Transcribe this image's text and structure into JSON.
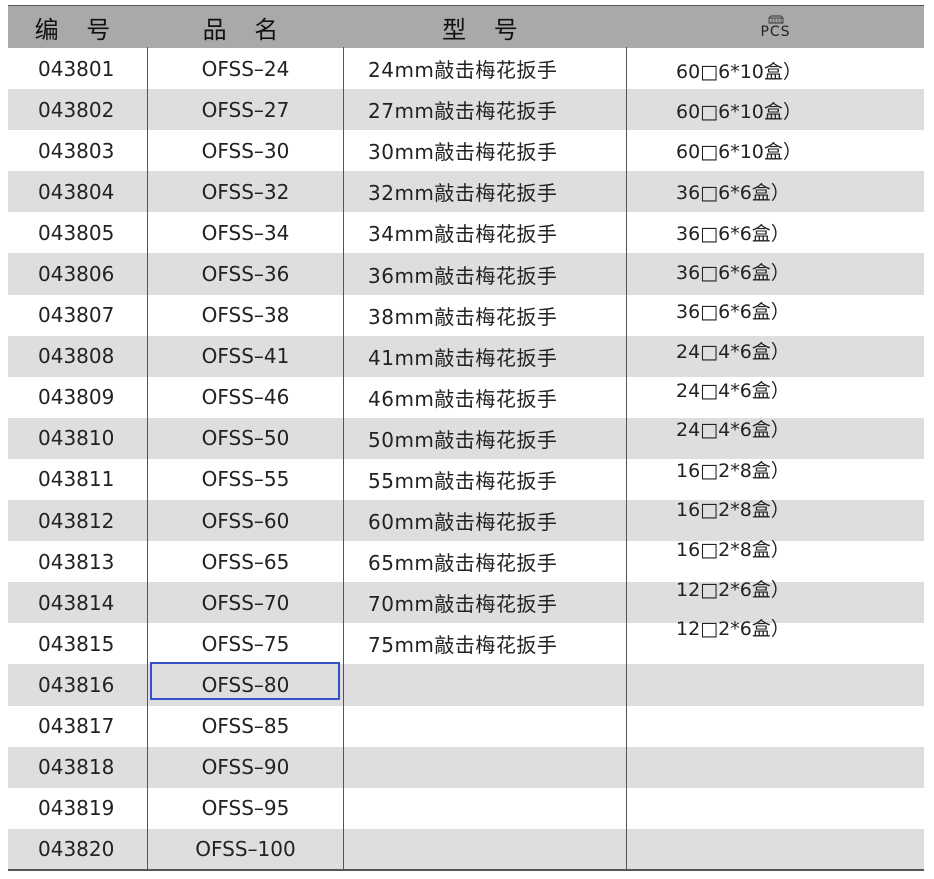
{
  "header": {
    "col1": "编 号",
    "col2": "品 名",
    "col3": "型 号",
    "col4": "PCS",
    "col4_icon": "box-icon"
  },
  "rows": [
    {
      "code": "043801",
      "name": "OFSS–24",
      "model": "24mm敲击梅花扳手"
    },
    {
      "code": "043802",
      "name": "OFSS–27",
      "model": "27mm敲击梅花扳手"
    },
    {
      "code": "043803",
      "name": "OFSS–30",
      "model": "30mm敲击梅花扳手"
    },
    {
      "code": "043804",
      "name": "OFSS–32",
      "model": "32mm敲击梅花扳手"
    },
    {
      "code": "043805",
      "name": "OFSS–34",
      "model": "34mm敲击梅花扳手"
    },
    {
      "code": "043806",
      "name": "OFSS–36",
      "model": "36mm敲击梅花扳手"
    },
    {
      "code": "043807",
      "name": "OFSS–38",
      "model": "38mm敲击梅花扳手"
    },
    {
      "code": "043808",
      "name": "OFSS–41",
      "model": "41mm敲击梅花扳手"
    },
    {
      "code": "043809",
      "name": "OFSS–46",
      "model": "46mm敲击梅花扳手"
    },
    {
      "code": "043810",
      "name": "OFSS–50",
      "model": "50mm敲击梅花扳手"
    },
    {
      "code": "043811",
      "name": "OFSS–55",
      "model": "55mm敲击梅花扳手"
    },
    {
      "code": "043812",
      "name": "OFSS–60",
      "model": "60mm敲击梅花扳手"
    },
    {
      "code": "043813",
      "name": "OFSS–65",
      "model": "65mm敲击梅花扳手"
    },
    {
      "code": "043814",
      "name": "OFSS–70",
      "model": "70mm敲击梅花扳手"
    },
    {
      "code": "043815",
      "name": "OFSS–75",
      "model": "75mm敲击梅花扳手"
    },
    {
      "code": "043816",
      "name": "OFSS–80",
      "model": ""
    },
    {
      "code": "043817",
      "name": "OFSS–85",
      "model": ""
    },
    {
      "code": "043818",
      "name": "OFSS–90",
      "model": ""
    },
    {
      "code": "043819",
      "name": "OFSS–95",
      "model": ""
    },
    {
      "code": "043820",
      "name": "OFSS–100",
      "model": ""
    }
  ],
  "packing": [
    "60□6*10盒）",
    "60□6*10盒）",
    "60□6*10盒）",
    "36□6*6盒）",
    "36□6*6盒）",
    "36□6*6盒）",
    "36□6*6盒）",
    "24□4*6盒）",
    "24□4*6盒）",
    "24□4*6盒）",
    "16□2*8盒）",
    "16□2*8盒）",
    "16□2*8盒）",
    "12□2*6盒）",
    "12□2*6盒）"
  ],
  "selected_code": "043816",
  "colors": {
    "header_bg": "#a9a9a9",
    "stripe": "#dedede",
    "selection": "#3550c8"
  }
}
